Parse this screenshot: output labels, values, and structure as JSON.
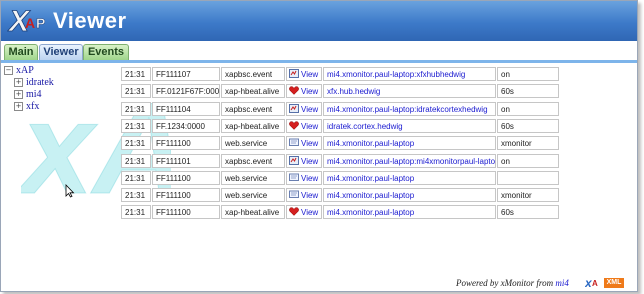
{
  "app": {
    "title": "Viewer",
    "logo_text": "xAP"
  },
  "tabs": [
    {
      "label": "Main",
      "active": false
    },
    {
      "label": "Viewer",
      "active": true
    },
    {
      "label": "Events",
      "active": false
    }
  ],
  "watermark_text": "xAP",
  "tree": {
    "root": "xAP",
    "children": [
      "idratek",
      "mi4",
      "xfx"
    ]
  },
  "messages": {
    "view_label": "View",
    "rows": [
      {
        "time": "21:31",
        "source": "FF111107",
        "class": "xapbsc.event",
        "icon": "view-icon",
        "address": "mi4.xmonitor.paul-laptop:xfxhubhedwig",
        "value": "on"
      },
      {
        "time": "21:31",
        "source": "FF.0121F67F:0000",
        "class": "xap-hbeat.alive",
        "icon": "heart-icon",
        "address": "xfx.hub.hedwig",
        "value": "60s"
      },
      {
        "time": "21:31",
        "source": "FF111104",
        "class": "xapbsc.event",
        "icon": "view-icon",
        "address": "mi4.xmonitor.paul-laptop:idratekcortexhedwig",
        "value": "on"
      },
      {
        "time": "21:31",
        "source": "FF.1234:0000",
        "class": "xap-hbeat.alive",
        "icon": "heart-icon",
        "address": "idratek.cortex.hedwig",
        "value": "60s"
      },
      {
        "time": "21:31",
        "source": "FF111100",
        "class": "web.service",
        "icon": "web-icon",
        "address": "mi4.xmonitor.paul-laptop",
        "value": "xmonitor"
      },
      {
        "time": "21:31",
        "source": "FF111101",
        "class": "xapbsc.event",
        "icon": "view-icon",
        "address": "mi4.xmonitor.paul-laptop:mi4xmonitorpaul-laptop",
        "value": "on"
      },
      {
        "time": "21:31",
        "source": "FF111100",
        "class": "web.service",
        "icon": "web-icon",
        "address": "mi4.xmonitor.paul-laptop",
        "value": ""
      },
      {
        "time": "21:31",
        "source": "FF111100",
        "class": "web.service",
        "icon": "web-icon",
        "address": "mi4.xmonitor.paul-laptop",
        "value": "xmonitor"
      },
      {
        "time": "21:31",
        "source": "FF111100",
        "class": "xap-hbeat.alive",
        "icon": "heart-icon",
        "address": "mi4.xmonitor.paul-laptop",
        "value": "60s"
      }
    ]
  },
  "footer": {
    "powered_by": "Powered by xMonitor from ",
    "link": "mi4",
    "badge": "XML"
  },
  "colors": {
    "header": "#3d7ac9",
    "tab_green": "#9fd58b",
    "link": "#1a1ad0",
    "heart": "#d42020",
    "xml_badge": "#ef7a1a"
  }
}
